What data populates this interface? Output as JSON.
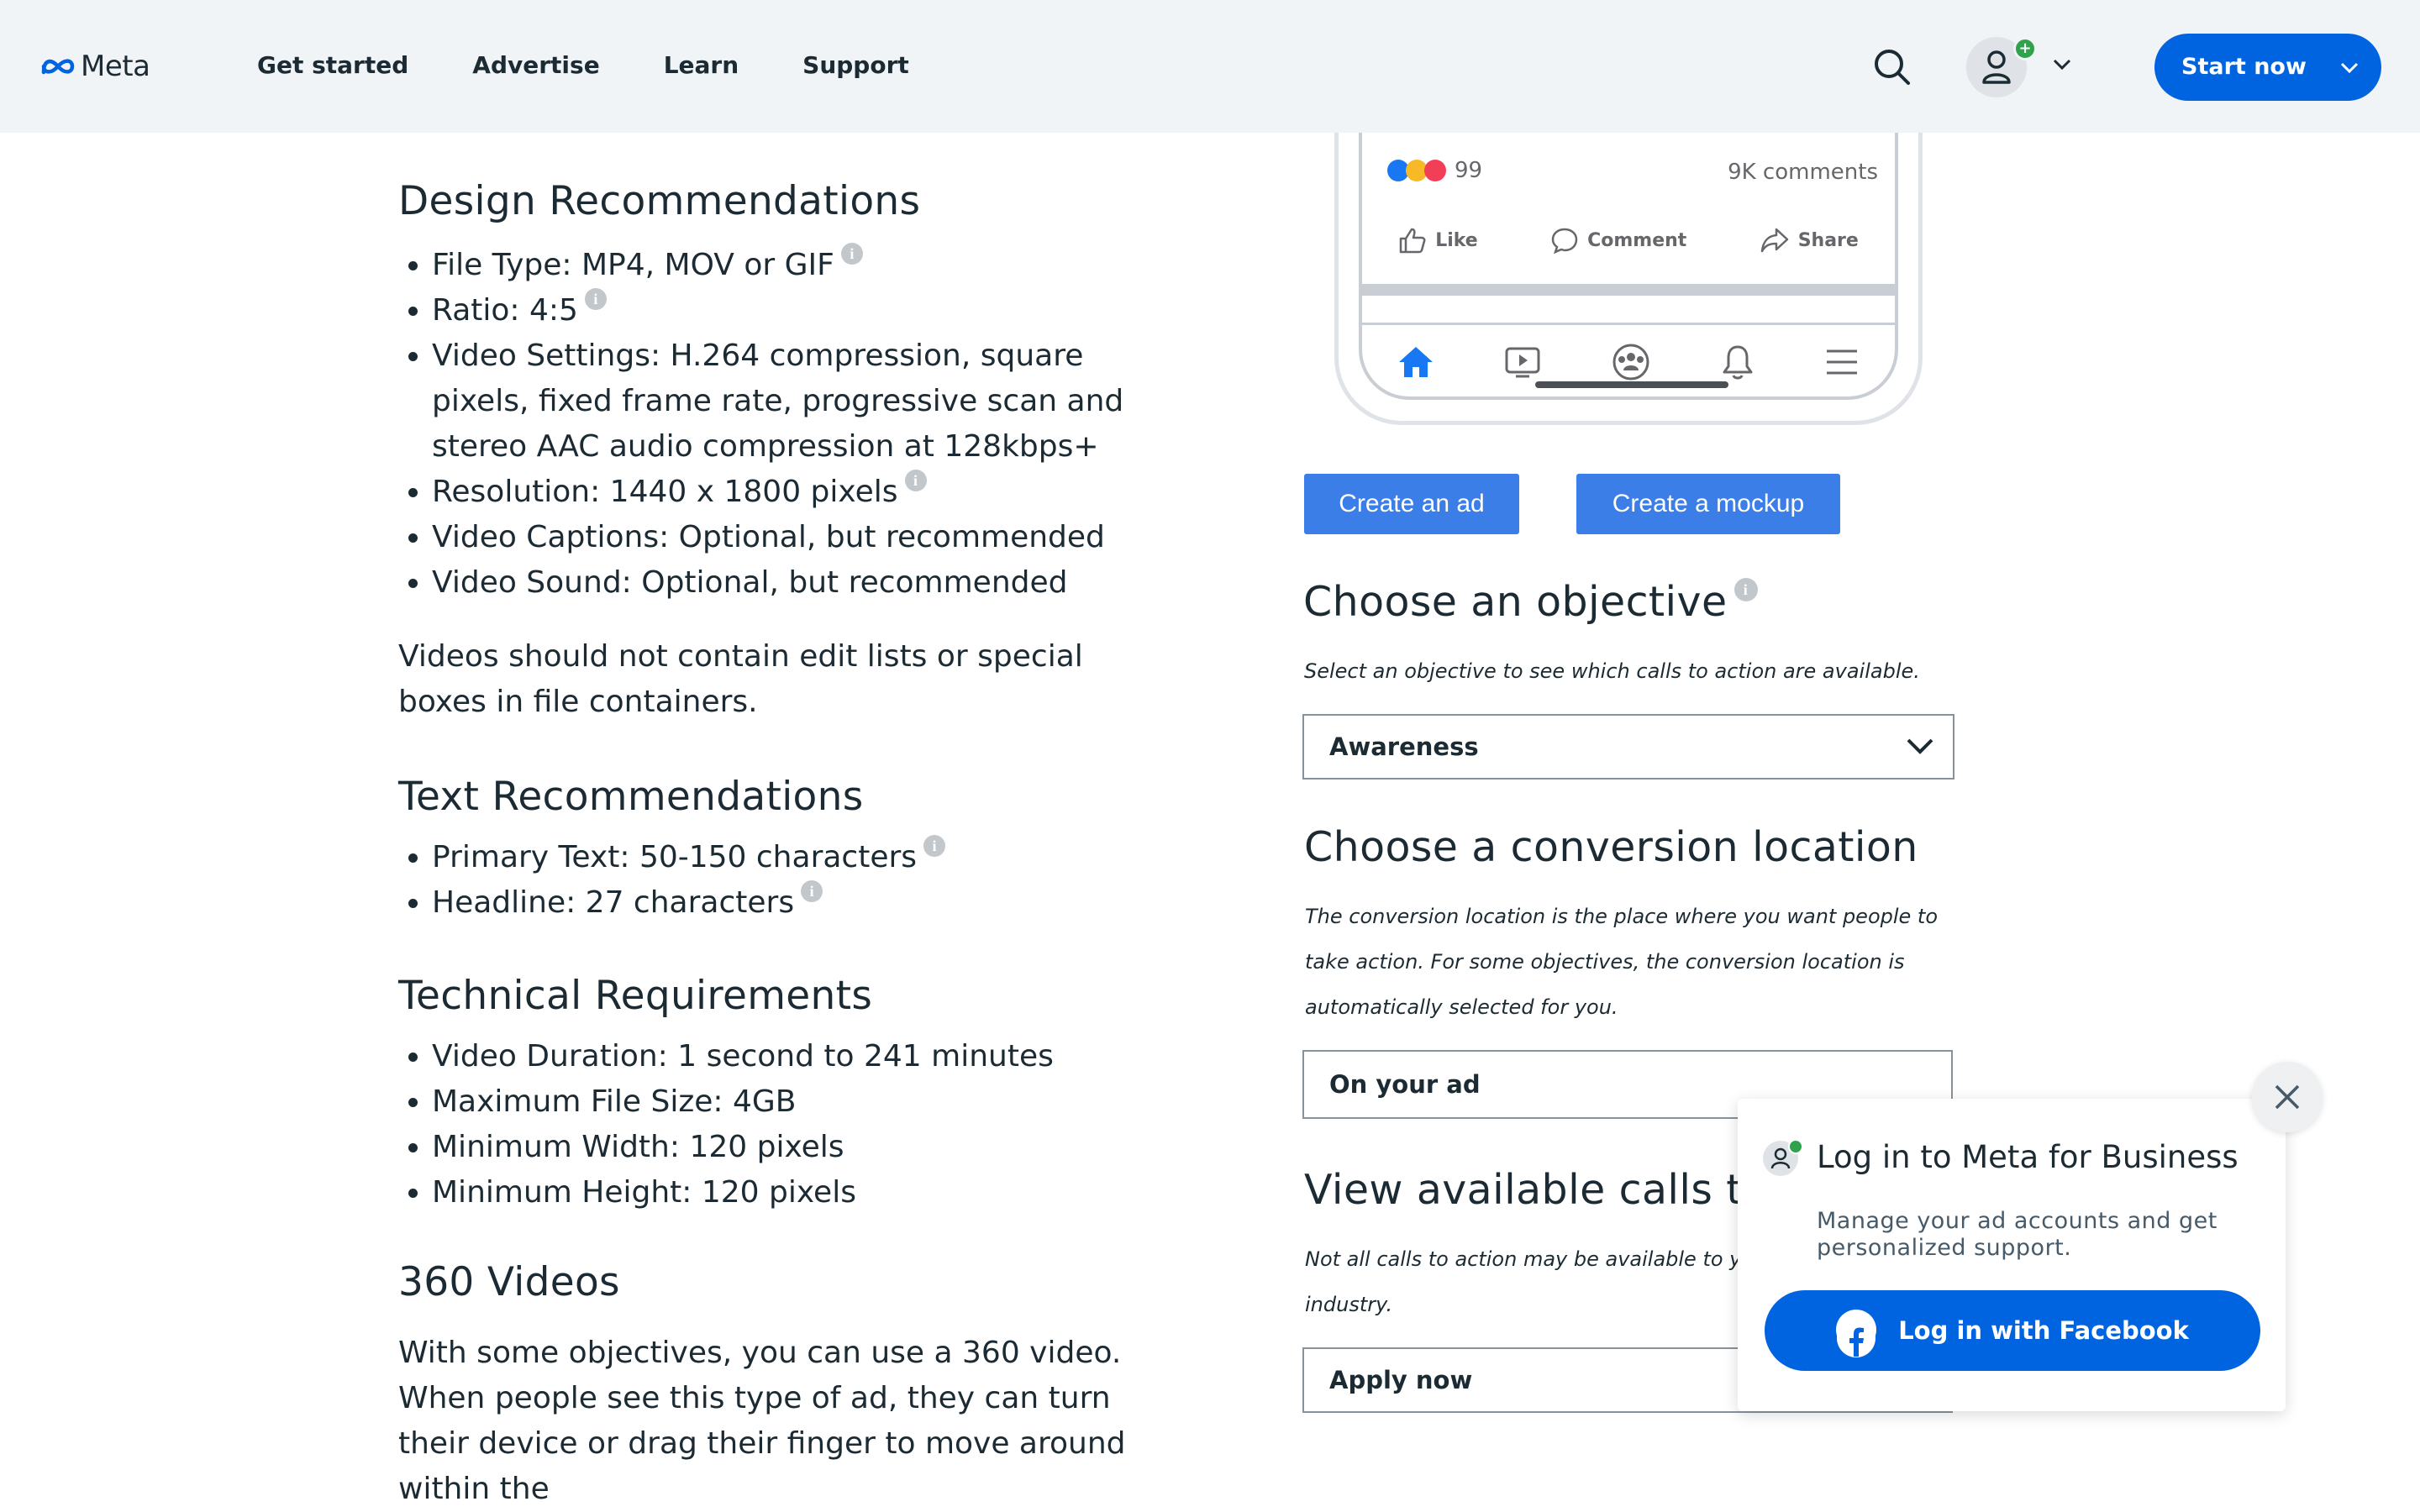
{
  "header": {
    "logo_text": "Meta",
    "nav": [
      "Get started",
      "Advertise",
      "Learn",
      "Support"
    ],
    "start_button": "Start now"
  },
  "design": {
    "title": "Design Recommendations",
    "items": [
      "File Type: MP4, MOV or GIF",
      "Ratio: 4:5",
      "Video Settings: H.264 compression, square pixels, fixed frame rate, progressive scan and stereo AAC audio compression at 128kbps+",
      "Resolution: 1440 x 1800 pixels",
      "Video Captions: Optional, but recommended",
      "Video Sound: Optional, but recommended"
    ],
    "note": "Videos should not contain edit lists or special boxes in file containers."
  },
  "text_rec": {
    "title": "Text Recommendations",
    "items": [
      "Primary Text: 50-150 characters",
      "Headline: 27 characters"
    ]
  },
  "technical": {
    "title": "Technical Requirements",
    "items": [
      "Video Duration: 1 second to 241 minutes",
      "Maximum File Size: 4GB",
      "Minimum Width: 120 pixels",
      "Minimum Height: 120 pixels"
    ]
  },
  "videos360": {
    "title": "360 Videos",
    "body": "With some objectives, you can use a 360 video. When people see this type of ad, they can turn their device or drag their finger to move around within the"
  },
  "mockup": {
    "reaction_count": "99",
    "comments": "9K comments",
    "like": "Like",
    "comment": "Comment",
    "share": "Share"
  },
  "buttons": {
    "create_ad": "Create an ad",
    "create_mockup": "Create a mockup"
  },
  "objective": {
    "title": "Choose an objective",
    "subtitle": "Select an objective to see which calls to action are available.",
    "selected": "Awareness"
  },
  "conversion": {
    "title": "Choose a conversion location",
    "subtitle_lines": [
      "The conversion location is the place where you want people to",
      "take action. For some objectives, the conversion location is",
      "automatically selected for you."
    ],
    "selected": "On your ad"
  },
  "cta": {
    "title": "View available calls to",
    "subtitle_lines": [
      "Not all calls to action may be available to yo",
      "industry."
    ],
    "selected": "Apply now"
  },
  "popup": {
    "title": "Log in to Meta for Business",
    "description": "Manage your ad accounts and get personalized support.",
    "button": "Log in with Facebook"
  },
  "colors": {
    "brand_blue": "#0064e0",
    "button_blue": "#3b7ee8",
    "header_bg": "#f1f4f7",
    "text": "#1c2b33"
  }
}
